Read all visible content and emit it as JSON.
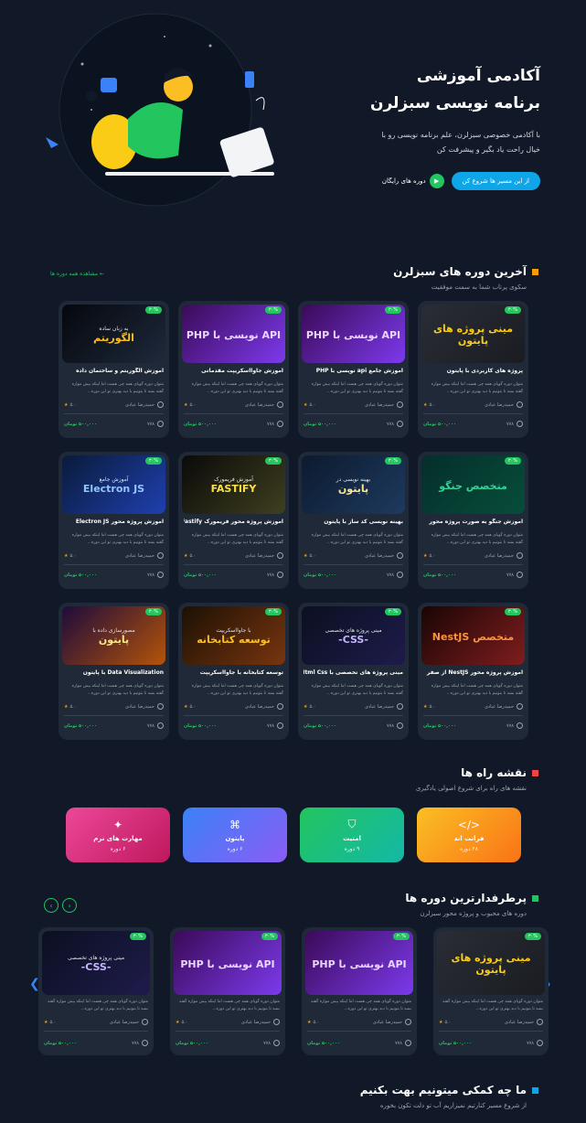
{
  "hero": {
    "title_line1": "آکادمی آموزشی",
    "title_line2": "برنامه نویسی سبزلرن",
    "desc_line1": "با آکادمی خصوصی سبزلرن، علم برنامه نویسی رو با",
    "desc_line2": "خیال راحت یاد بگیر و پیشرفت کن",
    "primary_btn": "از این مسیر ها شروع کن",
    "free_btn": "دوره های رایگان"
  },
  "latest": {
    "title": "آخرین دوره های سبزلرن",
    "subtitle": "سکوی پرتاب شما به سمت موفقیت",
    "see_all": "مشاهده همه دوره ها  ←",
    "accent": "#f59e0b"
  },
  "card_common": {
    "desc": "متوان دوره گویای همه چی هست اما اینکه بیش مواره گفته بشه تا بتونیم با دید بهتری تو این دوره...",
    "teacher": "حمیدرضا عبادی",
    "rating": "۵.۰",
    "students": "۷۷۸",
    "price": "۵۰۰,۰۰۰ تومان",
    "badge": "۳۰%"
  },
  "courses": [
    {
      "title": "پروژه های کاربردی با پایتون",
      "thumb": "مینی پروژه های پایتون",
      "thumb_sub": "",
      "theme": "py"
    },
    {
      "title": "آموزش جامع api نویسی با PHP",
      "thumb": "API نویسی با PHP",
      "thumb_sub": "",
      "theme": "php"
    },
    {
      "title": "آموزش جاوااسکریپت مقدماتی",
      "thumb": "API نویسی با PHP",
      "thumb_sub": "",
      "theme": "php"
    },
    {
      "title": "آموزش الگوریتم و ساختمان داده",
      "thumb": "الگوریتم",
      "thumb_sub": "به زبان ساده",
      "theme": "algo"
    },
    {
      "title": "آموزش جنگو به صورت پروژه محور",
      "thumb": "متخصص جنگو",
      "thumb_sub": "",
      "theme": "django"
    },
    {
      "title": "بهینه نویسی کد ساز با پایتون",
      "thumb": "پایتون",
      "thumb_sub": "بهینه نویسی در",
      "theme": "pyopt"
    },
    {
      "title": "آموزش پروژه محور فریمورک Fastify",
      "thumb": "FASTIFY",
      "thumb_sub": "آموزش فریمورک",
      "theme": "fastify"
    },
    {
      "title": "آموزش پروژه محور Electron JS",
      "thumb": "Electron JS",
      "thumb_sub": "آموزش جامع",
      "theme": "electron"
    },
    {
      "title": "آموزش پروژه محور NestJS از صفر",
      "thumb": "متخصص NestJS",
      "thumb_sub": "",
      "theme": "nest"
    },
    {
      "title": "مینی پروژه های تخصصی با Html Css",
      "thumb": "-CSS-",
      "thumb_sub": "مینی پروژه های تخصصی",
      "theme": "css"
    },
    {
      "title": "توسعه کتابخانه با جاوااسکریپت",
      "thumb": "توسعه کتابخانه",
      "thumb_sub": "با جاوااسکریپت",
      "theme": "lib"
    },
    {
      "title": "Data Visualization با پایتون",
      "thumb": "پایتون",
      "thumb_sub": "مصورسازی داده با",
      "theme": "dataviz"
    }
  ],
  "roadmap": {
    "title": "نقشه راه ها",
    "subtitle": "نقشه های راه برای شروع اصولی یادگیری",
    "accent": "#ef4444",
    "items": [
      {
        "name": "فرانت اند",
        "count": "۲۸ دوره",
        "icon": "</>",
        "grad": "linear-gradient(135deg,#fbbf24,#f97316)"
      },
      {
        "name": "امنیت",
        "count": "۹ دوره",
        "icon": "⛉",
        "grad": "linear-gradient(135deg,#22c55e,#14b8a6)"
      },
      {
        "name": "پایتون",
        "count": "۶ دوره",
        "icon": "⌘",
        "grad": "linear-gradient(135deg,#3b82f6,#8b5cf6)"
      },
      {
        "name": "مهارت های نرم",
        "count": "۶ دوره",
        "icon": "✦",
        "grad": "linear-gradient(135deg,#ec4899,#be185d)"
      }
    ]
  },
  "popular": {
    "title": "پرطرفدارترین دوره ها",
    "subtitle": "دوره های محبوب و پروژه محور سبزلرن",
    "accent": "#22c55e",
    "courses": [
      {
        "thumb": "مینی پروژه های پایتون",
        "thumb_sub": "",
        "theme": "py"
      },
      {
        "thumb": "API نویسی با PHP",
        "thumb_sub": "",
        "theme": "php"
      },
      {
        "thumb": "API نویسی با PHP",
        "thumb_sub": "",
        "theme": "php"
      },
      {
        "thumb": "-CSS-",
        "thumb_sub": "مینی پروژه های تخصصی",
        "theme": "css"
      }
    ]
  },
  "help": {
    "title": "ما چه کمکی میتونیم بهت بکنیم",
    "subtitle": "از شروع مسیر کنارتیم نمیزاریم آب تو دلت تکون بخوره",
    "accent": "#0ea5e9"
  }
}
